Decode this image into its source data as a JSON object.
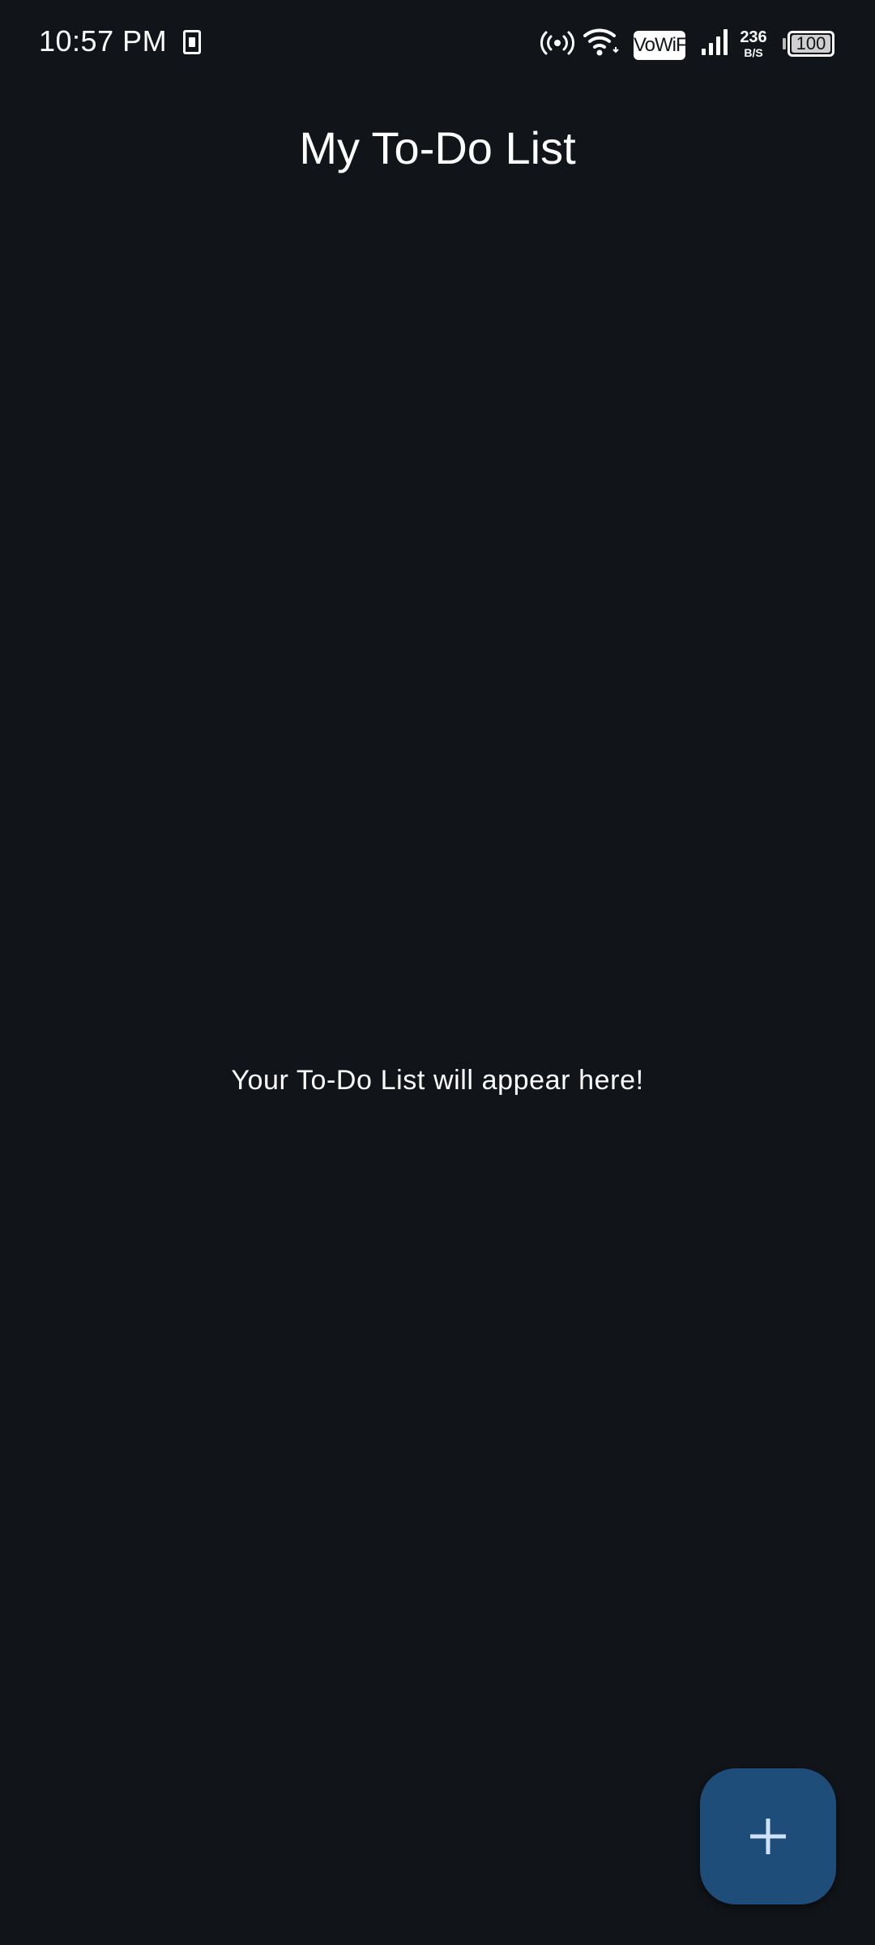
{
  "status_bar": {
    "time": "10:57 PM",
    "icons": [
      "sim-card-icon",
      "hotspot-icon",
      "wifi-icon",
      "signal-icon",
      "battery-icon"
    ],
    "vowifi": "VoWiFi",
    "speed_value": "236",
    "speed_unit": "B/S",
    "battery": "100"
  },
  "app_bar": {
    "title": "My To-Do List"
  },
  "main": {
    "empty_message": "Your To-Do List will appear here!"
  },
  "fab": {
    "icon": "plus-icon"
  },
  "colors": {
    "background": "#111418",
    "fab": "#1e4d7a",
    "fab_icon": "#cfe2f8",
    "text": "#ffffff"
  }
}
